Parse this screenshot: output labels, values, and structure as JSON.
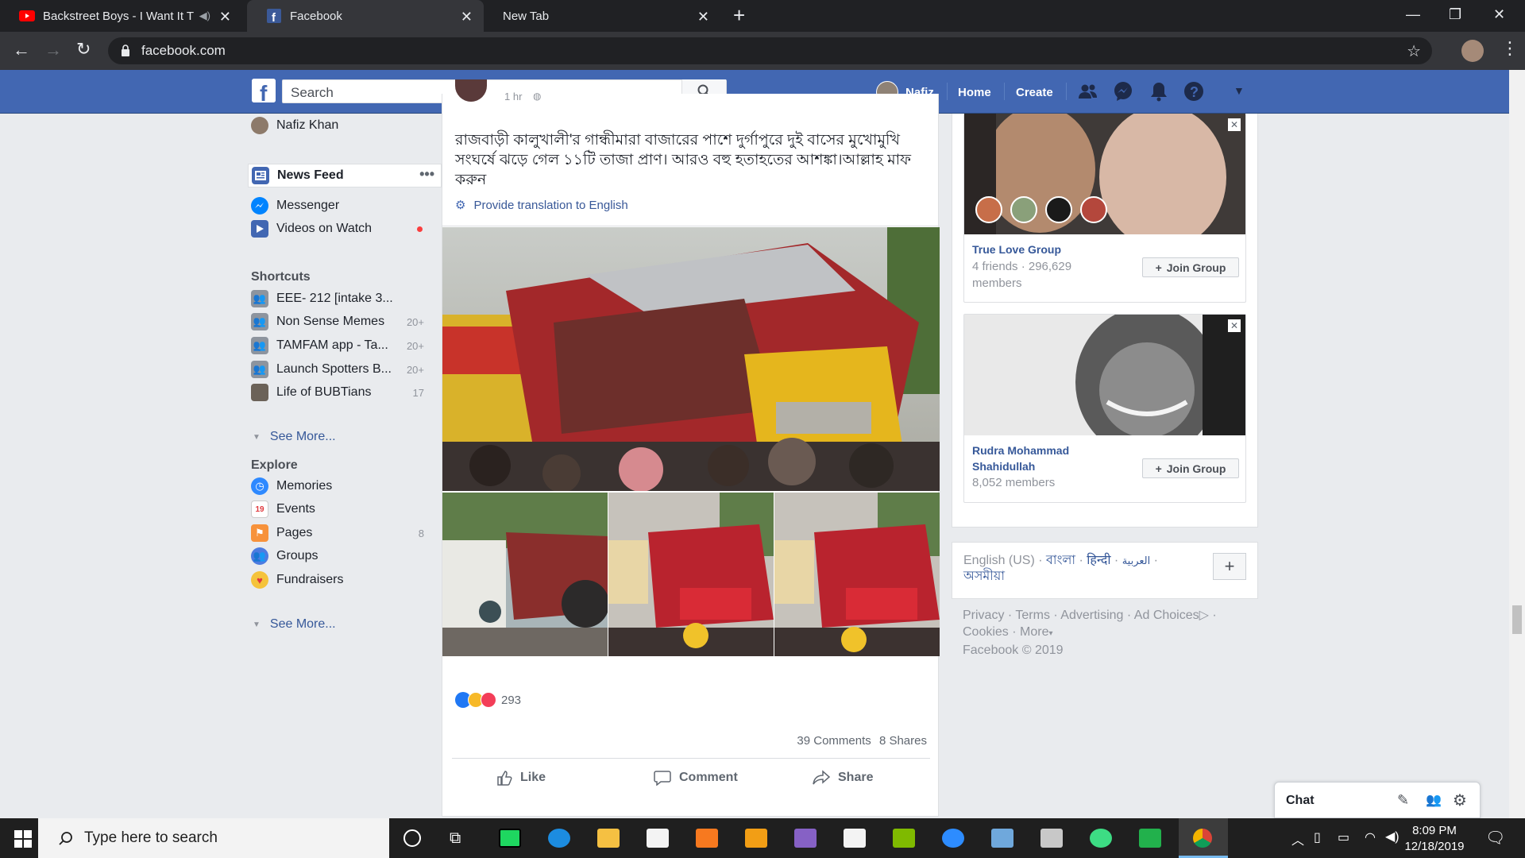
{
  "browser": {
    "tabs": [
      {
        "title": "Backstreet Boys - I Want It Th"
      },
      {
        "title": "Facebook"
      },
      {
        "title": "New Tab"
      }
    ],
    "url": "facebook.com"
  },
  "fb_header": {
    "search_placeholder": "Search",
    "user_name": "Nafiz",
    "nav": {
      "home": "Home",
      "create": "Create"
    }
  },
  "sidebar": {
    "profile_name": "Nafiz Khan",
    "main": [
      {
        "label": "News Feed"
      },
      {
        "label": "Messenger"
      },
      {
        "label": "Videos on Watch"
      }
    ],
    "shortcuts_heading": "Shortcuts",
    "shortcuts": [
      {
        "label": "EEE- 212 [intake 3...",
        "count": ""
      },
      {
        "label": "Non Sense Memes",
        "count": "20+"
      },
      {
        "label": "TAMFAM app - Ta...",
        "count": "20+"
      },
      {
        "label": "Launch Spotters B...",
        "count": "20+"
      },
      {
        "label": "Life of BUBTians",
        "count": "17"
      }
    ],
    "see_more": "See More...",
    "explore_heading": "Explore",
    "explore": [
      {
        "label": "Memories",
        "count": ""
      },
      {
        "label": "Events",
        "count": ""
      },
      {
        "label": "Pages",
        "count": "8"
      },
      {
        "label": "Groups",
        "count": ""
      },
      {
        "label": "Fundraisers",
        "count": ""
      }
    ],
    "see_more_2": "See More..."
  },
  "post": {
    "time": "1 hr",
    "text": "রাজবাড়ী কালুখালী'র গান্ধীমারা বাজারের পাশে দুর্গাপুরে দুই বাসের মুখোমুখি সংঘর্ষে ঝড়ে গেল ১১টি তাজা প্রাণ। আরও বহু হতাহতের আশঙ্কা।আল্লাহ মাফ করুন",
    "translate_link": "Provide translation to English",
    "reaction_count": "293",
    "comments": "39 Comments",
    "shares": "8 Shares",
    "actions": {
      "like": "Like",
      "comment": "Comment",
      "share": "Share"
    }
  },
  "suggested_groups": [
    {
      "name": "True Love Group",
      "meta": "4 friends · 296,629 members",
      "button": "Join Group"
    },
    {
      "name": "Rudra Mohammad Shahidullah",
      "meta": "8,052 members",
      "button": "Join Group"
    }
  ],
  "languages": {
    "current": "English (US)",
    "others": [
      "বাংলা",
      "हिन्दी",
      "العربية",
      "অসমীয়া"
    ]
  },
  "footer": {
    "links": [
      "Privacy",
      "Terms",
      "Advertising",
      "Ad Choices",
      "Cookies",
      "More"
    ],
    "copyright": "Facebook © 2019"
  },
  "chat": {
    "label": "Chat"
  },
  "taskbar": {
    "search_placeholder": "Type here to search",
    "time": "8:09 PM",
    "date": "12/18/2019"
  }
}
